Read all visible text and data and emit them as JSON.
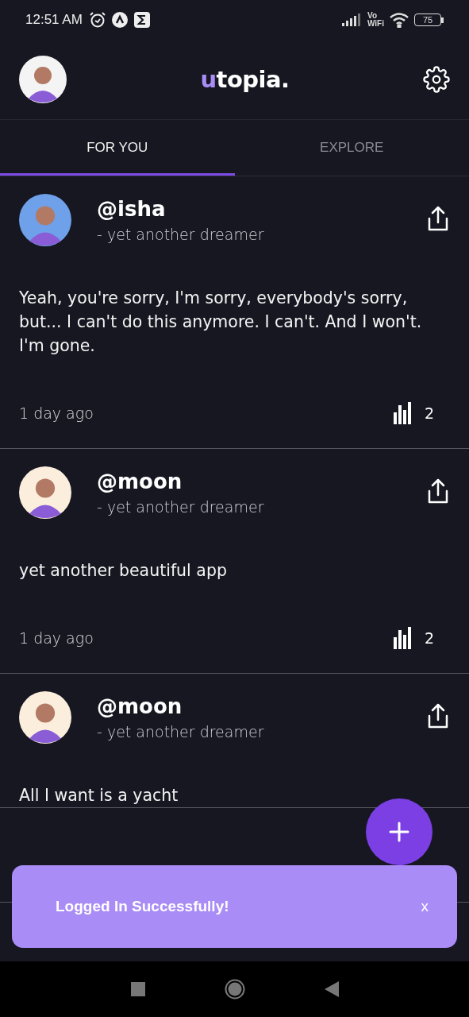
{
  "status_bar": {
    "time": "12:51 AM",
    "network_top": "Vo",
    "network_bottom": "WiFi",
    "battery": "75"
  },
  "header": {
    "logo_accent": "u",
    "logo_rest": "topia."
  },
  "tabs": [
    {
      "label": "FOR YOU",
      "selected": true
    },
    {
      "label": "EXPLORE",
      "selected": false
    }
  ],
  "posts": [
    {
      "username": "@isha",
      "tagline": "- yet another dreamer",
      "body": "Yeah, you're sorry, I'm sorry, everybody's sorry, but... I can't do this anymore. I can't. And I won't. I'm gone.",
      "time": "1 day ago",
      "views": "2"
    },
    {
      "username": "@moon",
      "tagline": "- yet another dreamer",
      "body": "yet another beautiful app",
      "time": "1 day ago",
      "views": "2"
    },
    {
      "username": "@moon",
      "tagline": "- yet another dreamer",
      "body": "All I want is a yacht"
    }
  ],
  "toast": {
    "message": "Logged In Successfully!",
    "close": "x"
  }
}
